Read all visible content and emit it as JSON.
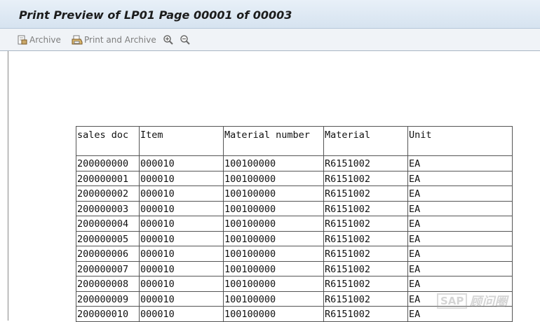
{
  "window": {
    "title": "Print Preview of LP01 Page 00001 of 00003"
  },
  "toolbar": {
    "archive_label": "Archive",
    "print_archive_label": "Print and Archive",
    "zoom_in_icon": "zoom-in-icon",
    "zoom_out_icon": "zoom-out-icon"
  },
  "report": {
    "columns": [
      "sales doc",
      "Item",
      "Material number",
      "Material",
      "Unit"
    ],
    "rows": [
      [
        "200000000",
        "000010",
        "100100000",
        "R6151002",
        "EA"
      ],
      [
        "200000001",
        "000010",
        "100100000",
        "R6151002",
        "EA"
      ],
      [
        "200000002",
        "000010",
        "100100000",
        "R6151002",
        "EA"
      ],
      [
        "200000003",
        "000010",
        "100100000",
        "R6151002",
        "EA"
      ],
      [
        "200000004",
        "000010",
        "100100000",
        "R6151002",
        "EA"
      ],
      [
        "200000005",
        "000010",
        "100100000",
        "R6151002",
        "EA"
      ],
      [
        "200000006",
        "000010",
        "100100000",
        "R6151002",
        "EA"
      ],
      [
        "200000007",
        "000010",
        "100100000",
        "R6151002",
        "EA"
      ],
      [
        "200000008",
        "000010",
        "100100000",
        "R6151002",
        "EA"
      ],
      [
        "200000009",
        "000010",
        "100100000",
        "R6151002",
        "EA"
      ],
      [
        "200000010",
        "000010",
        "100100000",
        "R6151002",
        "EA"
      ]
    ]
  },
  "watermark": {
    "brand": "SAP",
    "text": "顾问圈"
  }
}
